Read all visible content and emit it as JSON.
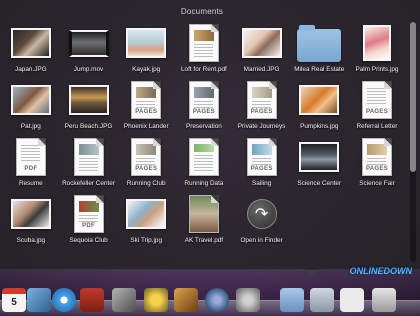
{
  "stack": {
    "title": "Documents",
    "items": [
      {
        "label": "Japan.JPG",
        "kind": "photo"
      },
      {
        "label": "Jump.mov",
        "kind": "photo"
      },
      {
        "label": "Kayak.jpg",
        "kind": "photo"
      },
      {
        "label": "Loft for Rent.pdf",
        "kind": "doc"
      },
      {
        "label": "Married.JPG",
        "kind": "photo"
      },
      {
        "label": "Milea Real Estate",
        "kind": "folder"
      },
      {
        "label": "Palm Prints.jpg",
        "kind": "photo"
      },
      {
        "label": "Pat.jpg",
        "kind": "photo"
      },
      {
        "label": "Peru Beach.JPG",
        "kind": "photo"
      },
      {
        "label": "Phoenix Lander",
        "kind": "doc",
        "tag": "PAGES"
      },
      {
        "label": "Preservation",
        "kind": "doc",
        "tag": "PAGES"
      },
      {
        "label": "Private Journeys",
        "kind": "doc",
        "tag": "PAGES"
      },
      {
        "label": "Pumpkins.jpg",
        "kind": "photo"
      },
      {
        "label": "Referral Letter",
        "kind": "doc",
        "tag": "PAGES"
      },
      {
        "label": "Resume",
        "kind": "doc",
        "tag": "PDF"
      },
      {
        "label": "Rockefeller Center",
        "kind": "doc"
      },
      {
        "label": "Running Club",
        "kind": "doc",
        "tag": "PAGES"
      },
      {
        "label": "Running Data",
        "kind": "doc"
      },
      {
        "label": "Sailing",
        "kind": "doc",
        "tag": "PAGES"
      },
      {
        "label": "Science Center",
        "kind": "photo"
      },
      {
        "label": "Science Fair",
        "kind": "doc",
        "tag": "PAGES"
      },
      {
        "label": "Scuba.jpg",
        "kind": "photo"
      },
      {
        "label": "Sequoia Club",
        "kind": "doc",
        "tag": "PDF"
      },
      {
        "label": "Ski Trip.jpg",
        "kind": "photo"
      },
      {
        "label": "AK Travel.pdf",
        "kind": "doc"
      },
      {
        "label": "Open in Finder",
        "kind": "action"
      }
    ]
  },
  "dock": {
    "calendar_day": "5"
  },
  "colors": {
    "accent": "#3fb0ff",
    "folder": "#8fb6dd",
    "panel": "#282828"
  }
}
